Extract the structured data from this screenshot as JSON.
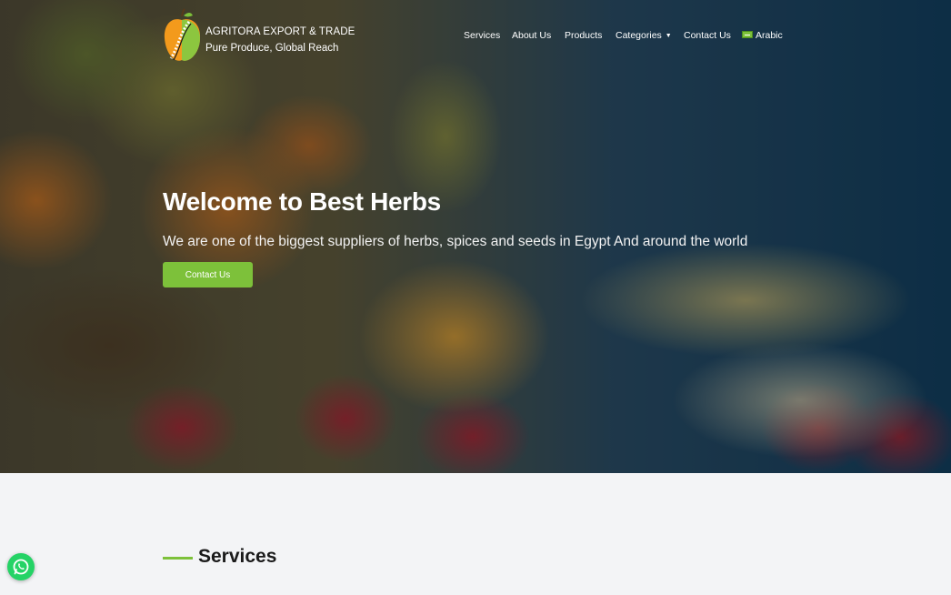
{
  "brand": {
    "name": "AGRITORA EXPORT & TRADE",
    "tagline": "Pure Produce, Global Reach",
    "logo_icon": "apple-logo-icon"
  },
  "nav": {
    "items": [
      {
        "label": "Services"
      },
      {
        "label": "About Us"
      },
      {
        "label": "Products"
      },
      {
        "label": "Categories",
        "has_dropdown": true
      },
      {
        "label": "Contact Us"
      },
      {
        "label": "Arabic",
        "icon": "saudi-flag-icon"
      }
    ]
  },
  "hero": {
    "title": "Welcome to Best Herbs",
    "subtitle": "We are one of the biggest suppliers of herbs, spices and seeds in Egypt And around the world",
    "button_label": "Contact Us",
    "background_image": "fruit-basket-photo"
  },
  "services": {
    "heading": "Services"
  },
  "whatsapp": {
    "icon": "whatsapp-icon"
  },
  "colors": {
    "accent": "#7dc13a",
    "section_bg": "#f3f4f6",
    "whatsapp": "#25d366"
  }
}
